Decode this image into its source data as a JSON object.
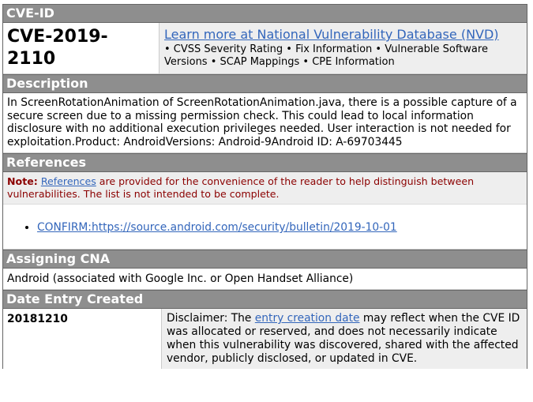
{
  "cve_id_section": {
    "header": "CVE-ID",
    "cve_id": "CVE-2019-2110",
    "nvd_link_text": "Learn more at National Vulnerability Database (NVD)",
    "nvd_subtext": "• CVSS Severity Rating • Fix Information • Vulnerable Software Versions • SCAP Mappings • CPE Information"
  },
  "description_section": {
    "header": "Description",
    "text": "In ScreenRotationAnimation of ScreenRotationAnimation.java, there is a possible capture of a secure screen due to a missing permission check. This could lead to local information disclosure with no additional execution privileges needed. User interaction is not needed for exploitation.Product: AndroidVersions: Android-9Android ID: A-69703445"
  },
  "references_section": {
    "header": "References",
    "note_label": "Note:",
    "note_link": "References",
    "note_rest": " are provided for the convenience of the reader to help distinguish between vulnerabilities. The list is not intended to be complete.",
    "items": [
      "CONFIRM:https://source.android.com/security/bulletin/2019-10-01"
    ]
  },
  "cna_section": {
    "header": "Assigning CNA",
    "text": "Android (associated with Google Inc. or Open Handset Alliance)"
  },
  "date_section": {
    "header": "Date Entry Created",
    "date": "20181210",
    "disclaimer_pre": "Disclaimer: The ",
    "disclaimer_link": "entry creation date",
    "disclaimer_post": " may reflect when the CVE ID was allocated or reserved, and does not necessarily indicate when this vulnerability was discovered, shared with the affected vendor, publicly disclosed, or updated in CVE."
  },
  "colors": {
    "header_bg": "#8e8e8e",
    "link": "#3366bb",
    "note_text": "#8b0000",
    "shaded_cell": "#eeeeee"
  }
}
